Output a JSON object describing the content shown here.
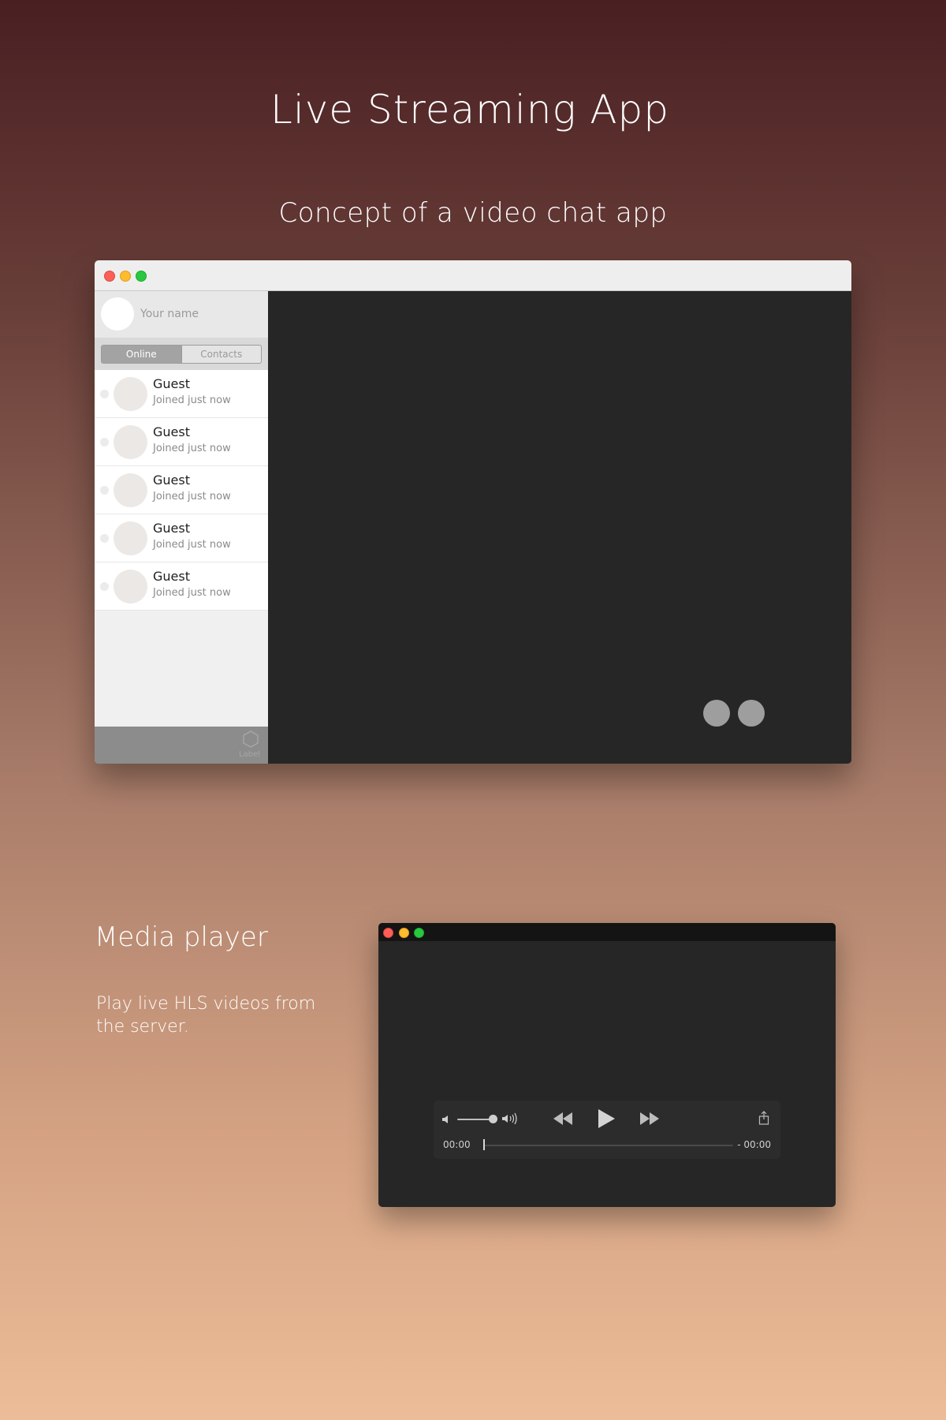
{
  "header": {
    "title": "Live Streaming App",
    "subtitle": "Concept of a video chat app"
  },
  "chat_window": {
    "profile": {
      "name_placeholder": "Your name"
    },
    "tabs": [
      {
        "label": "Online",
        "active": true
      },
      {
        "label": "Contacts",
        "active": false
      }
    ],
    "users": [
      {
        "name": "Guest",
        "status": "Joined just now"
      },
      {
        "name": "Guest",
        "status": "Joined just now"
      },
      {
        "name": "Guest",
        "status": "Joined just now"
      },
      {
        "name": "Guest",
        "status": "Joined just now"
      },
      {
        "name": "Guest",
        "status": "Joined just now"
      }
    ],
    "footer": {
      "icon": "hexagon-icon",
      "label": "Label"
    },
    "video_controls": [
      "call-control-1",
      "call-control-2"
    ]
  },
  "media_section": {
    "heading": "Media player",
    "description": "Play live HLS videos from the server."
  },
  "player": {
    "elapsed": "00:00",
    "remaining": "- 00:00",
    "volume_level": 0.85,
    "progress": 0.0
  },
  "colors": {
    "close": "#fc5f57",
    "minimize": "#fdbc2e",
    "zoom": "#29c840",
    "video_bg": "#262626"
  }
}
